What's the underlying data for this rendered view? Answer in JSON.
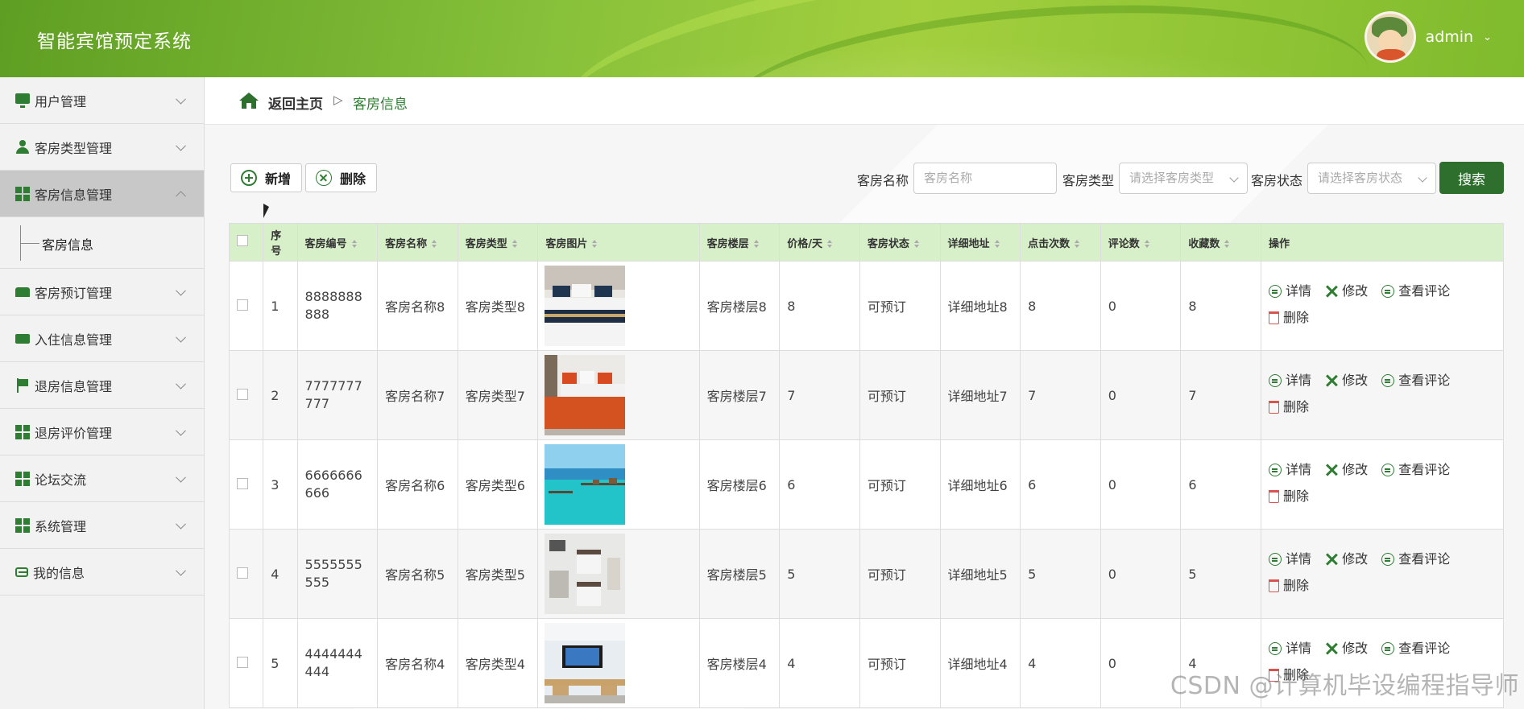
{
  "app": {
    "title": "智能宾馆预定系统",
    "username": "admin"
  },
  "sidebar": {
    "items": [
      {
        "label": "用户管理",
        "icon": "monitor-icon"
      },
      {
        "label": "客房类型管理",
        "icon": "user-icon"
      },
      {
        "label": "客房信息管理",
        "icon": "grid-icon",
        "active": true
      },
      {
        "label": "客房预订管理",
        "icon": "bed-icon"
      },
      {
        "label": "入住信息管理",
        "icon": "wallet-icon"
      },
      {
        "label": "退房信息管理",
        "icon": "flag-icon"
      },
      {
        "label": "退房评价管理",
        "icon": "grid-icon"
      },
      {
        "label": "论坛交流",
        "icon": "grid-icon"
      },
      {
        "label": "系统管理",
        "icon": "grid-icon"
      },
      {
        "label": "我的信息",
        "icon": "card-icon"
      }
    ],
    "submenu": "客房信息"
  },
  "breadcrumb": {
    "home": "返回主页",
    "separator": "▷",
    "current": "客房信息"
  },
  "toolbar": {
    "add": "新增",
    "delete": "删除"
  },
  "search": {
    "name_label": "客房名称",
    "name_placeholder": "客房名称",
    "type_label": "客房类型",
    "type_placeholder": "请选择客房类型",
    "status_label": "客房状态",
    "status_placeholder": "请选择客房状态",
    "button": "搜索"
  },
  "table": {
    "headers": [
      "序号",
      "客房编号",
      "客房名称",
      "客房类型",
      "客房图片",
      "客房楼层",
      "价格/天",
      "客房状态",
      "详细地址",
      "点击次数",
      "评论数",
      "收藏数",
      "操作"
    ],
    "rows": [
      {
        "idx": "1",
        "code": "8888888888",
        "name": "客房名称8",
        "type": "客房类型8",
        "floor": "客房楼层8",
        "price": "8",
        "status": "可预订",
        "address": "详细地址8",
        "clicks": "8",
        "comments": "0",
        "favs": "8",
        "image": "bedroom-navy-pattern"
      },
      {
        "idx": "2",
        "code": "7777777777",
        "name": "客房名称7",
        "type": "客房类型7",
        "floor": "客房楼层7",
        "price": "7",
        "status": "可预订",
        "address": "详细地址7",
        "clicks": "7",
        "comments": "0",
        "favs": "7",
        "image": "bedroom-orange-blanket"
      },
      {
        "idx": "3",
        "code": "6666666666",
        "name": "客房名称6",
        "type": "客房类型6",
        "floor": "客房楼层6",
        "price": "6",
        "status": "可预订",
        "address": "详细地址6",
        "clicks": "6",
        "comments": "0",
        "favs": "6",
        "image": "tropical-sea-villa"
      },
      {
        "idx": "4",
        "code": "5555555555",
        "name": "客房名称5",
        "type": "客房类型5",
        "floor": "客房楼层5",
        "price": "5",
        "status": "可预订",
        "address": "详细地址5",
        "clicks": "5",
        "comments": "0",
        "favs": "5",
        "image": "hotel-room-aerial"
      },
      {
        "idx": "5",
        "code": "4444444444",
        "name": "客房名称4",
        "type": "客房类型4",
        "floor": "客房楼层4",
        "price": "4",
        "status": "可预订",
        "address": "详细地址4",
        "clicks": "4",
        "comments": "0",
        "favs": "4",
        "image": "room-tv-desk"
      }
    ],
    "actions": {
      "detail": "详情",
      "edit": "修改",
      "comments": "查看评论",
      "delete": "删除"
    }
  },
  "watermark": "CSDN @计算机毕设编程指导师",
  "colors": {
    "accent": "#2e7d32",
    "header_green": "#86c03a",
    "table_header": "#d7f0c9",
    "search_button": "#2e6f2e"
  }
}
